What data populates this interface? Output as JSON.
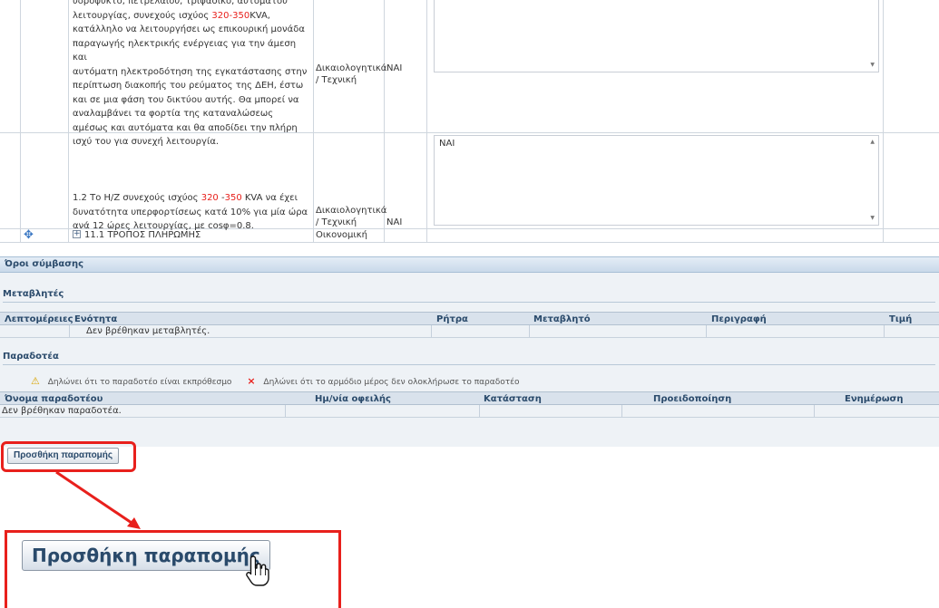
{
  "requirements": [
    {
      "text_lines": [
        "υδροψυκτο, πετρελαίου, τριφασικό, αυτόματου",
        "λειτουργίας, συνεχούς ισχύος ",
        "κατάλληλο να λειτουργήσει ως επικουρική μονάδα",
        "παραγωγής ηλεκτρικής ενέργειας για την άμεση και",
        "αυτόματη ηλεκτροδότηση της εγκατάστασης στην",
        "περίπτωση διακοπής του ρεύματος της ΔΕΗ, έστω",
        "και σε μια φάση του δικτύου αυτής. Θα μπορεί να",
        "αναλαμβάνει τα φορτία της καταναλώσεως",
        "αμέσως και αυτόματα και θα αποδίδει την πλήρη",
        "ισχύ του για συνεχή λειτουργία."
      ],
      "power_highlight": "320-350",
      "power_unit": "KVA,",
      "category": "Δικαιολογητικά / Τεχνική",
      "value": "ΝΑΙ",
      "response": ""
    },
    {
      "text_pre": "1.2 Το Η/Ζ συνεχούς ισχύος ",
      "highlight_a": "320",
      "dash": " -",
      "highlight_b": "350",
      "text_post": " KVA να έχει",
      "text_line2": "δυνατότητα υπερφορτίσεως κατά 10% για μία ώρα",
      "text_line3": "ανά 12 ώρες λειτουργίας, με cosφ=0.8.",
      "category": "Δικαιολογητικά / Τεχνική",
      "value": "ΝΑΙ",
      "response": "ΝΑΙ"
    }
  ],
  "section_row": {
    "label": "11.1 ΤΡΟΠΟΣ ΠΛΗΡΩΜΗΣ",
    "category": "Οικονομική",
    "expand_icon": "plus-box-icon",
    "move_icon": "four-way-arrow-icon"
  },
  "contract_terms": {
    "title": "Όροι σύμβασης",
    "variables": {
      "title": "Μεταβλητές",
      "columns": [
        "Λεπτομέρειες",
        "Ενότητα",
        "Ρήτρα",
        "Μεταβλητό",
        "Περιγραφή",
        "Τιμή"
      ],
      "empty_message": "Δεν βρέθηκαν μεταβλητές."
    },
    "deliverables": {
      "title": "Παραδοτέα",
      "legend_overdue": "Δηλώνει ότι το παραδοτέο είναι εκπρόθεσμο",
      "legend_incomplete": "Δηλώνει ότι το αρμόδιο μέρος δεν ολοκλήρωσε το παραδοτέο",
      "legend_overdue_icon": "warning-icon",
      "legend_incomplete_icon": "red-x-icon",
      "columns": [
        "Όνομα παραδοτέου",
        "Ημ/νία οφειλής",
        "Κατάσταση",
        "Προειδοποίηση",
        "Ενημέρωση"
      ],
      "empty_message": "Δεν βρέθηκαν παραδοτέα."
    }
  },
  "add_reference_button": "Προσθήκη παραπομής",
  "zoom_button_label": "Προσθήκη παραπομής",
  "cursor_icon": "hand-pointer-icon",
  "colors": {
    "highlight_red": "#e8201c",
    "header_blue": "#2a4a6b",
    "section_bar": "#c9d9ea"
  }
}
